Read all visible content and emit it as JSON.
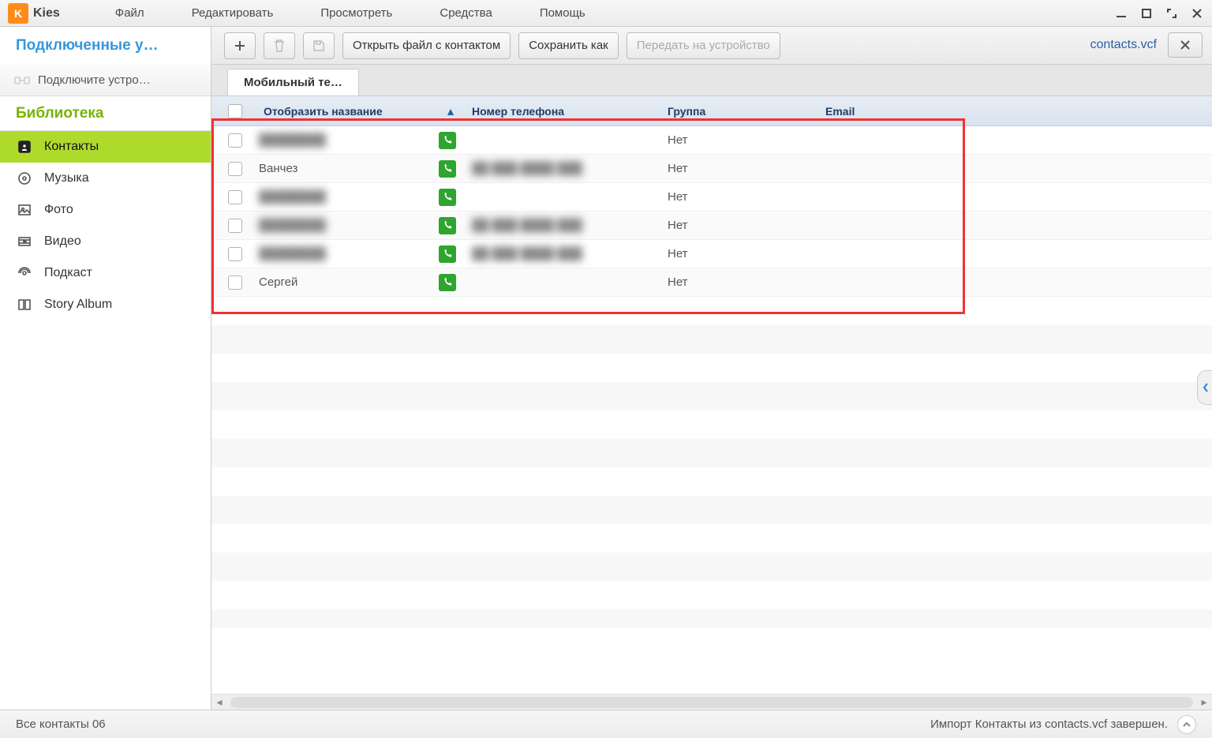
{
  "app": {
    "name": "Kies"
  },
  "menu": {
    "file": "Файл",
    "edit": "Редактировать",
    "view": "Просмотреть",
    "tools": "Средства",
    "help": "Помощь"
  },
  "sidebar": {
    "connected_header": "Подключенные у…",
    "connect_device": "Подключите устро…",
    "library_header": "Библиотека",
    "items": [
      {
        "label": "Контакты",
        "icon": "contacts-icon",
        "selected": true
      },
      {
        "label": "Музыка",
        "icon": "music-icon",
        "selected": false
      },
      {
        "label": "Фото",
        "icon": "photo-icon",
        "selected": false
      },
      {
        "label": "Видео",
        "icon": "video-icon",
        "selected": false
      },
      {
        "label": "Подкаст",
        "icon": "podcast-icon",
        "selected": false
      },
      {
        "label": "Story Album",
        "icon": "storyalbum-icon",
        "selected": false
      }
    ]
  },
  "toolbar": {
    "open_contact": "Открыть файл с контактом",
    "save_as": "Сохранить как",
    "send_to_device": "Передать на устройство",
    "filename": "contacts.vcf"
  },
  "tab": {
    "label": "Мобильный те…"
  },
  "table": {
    "cols": {
      "name": "Отобразить название",
      "phone": "Номер телефона",
      "group": "Группа",
      "email": "Email"
    },
    "rows": [
      {
        "name": "",
        "name_blurred": true,
        "phone": "",
        "phone_blurred": false,
        "group": "Нет"
      },
      {
        "name": "Ванчез",
        "name_blurred": false,
        "phone": "",
        "phone_blurred": true,
        "group": "Нет"
      },
      {
        "name": "",
        "name_blurred": true,
        "phone": "",
        "phone_blurred": false,
        "group": "Нет"
      },
      {
        "name": "",
        "name_blurred": true,
        "phone": "",
        "phone_blurred": true,
        "group": "Нет"
      },
      {
        "name": "",
        "name_blurred": true,
        "phone": "",
        "phone_blurred": true,
        "group": "Нет"
      },
      {
        "name": "Сергей",
        "name_blurred": false,
        "phone": "",
        "phone_blurred": false,
        "group": "Нет"
      }
    ]
  },
  "status": {
    "left": "Все контакты 06",
    "right": "Импорт Контакты из contacts.vcf завершен."
  }
}
